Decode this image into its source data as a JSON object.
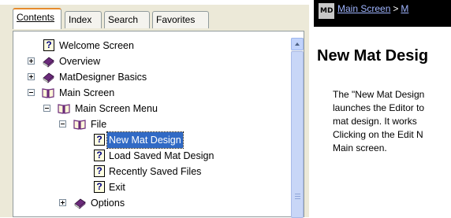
{
  "tabs": {
    "contents": "Contents",
    "index": "Index",
    "search": "Search",
    "favorites": "Favorites"
  },
  "tree": {
    "welcome": "Welcome Screen",
    "overview": "Overview",
    "basics": "MatDesigner Basics",
    "main_screen": "Main Screen",
    "main_menu": "Main Screen Menu",
    "file": "File",
    "new_mat": "New Mat Design",
    "load_saved": "Load Saved Mat Design",
    "recent": "Recently Saved Files",
    "exit": "Exit",
    "options": "Options"
  },
  "nav": {
    "logo_text": "MD",
    "crumb_main": "Main Screen",
    "separator": ">",
    "crumb_next": "M"
  },
  "content": {
    "title": "New Mat Desig",
    "lines": [
      "The \"New Mat Design",
      "launches the Editor to",
      "mat design. It works",
      "Clicking on the Edit N",
      "Main screen."
    ]
  },
  "colors": {
    "selection": "#316ac5",
    "tab_accent": "#e68b2c",
    "book_purple": "#6a2a7a",
    "nav_link": "#9fb5ff"
  },
  "icons": {
    "help_topic": "question-page-icon",
    "closed_book": "closed-book-icon",
    "open_book": "open-book-icon"
  }
}
